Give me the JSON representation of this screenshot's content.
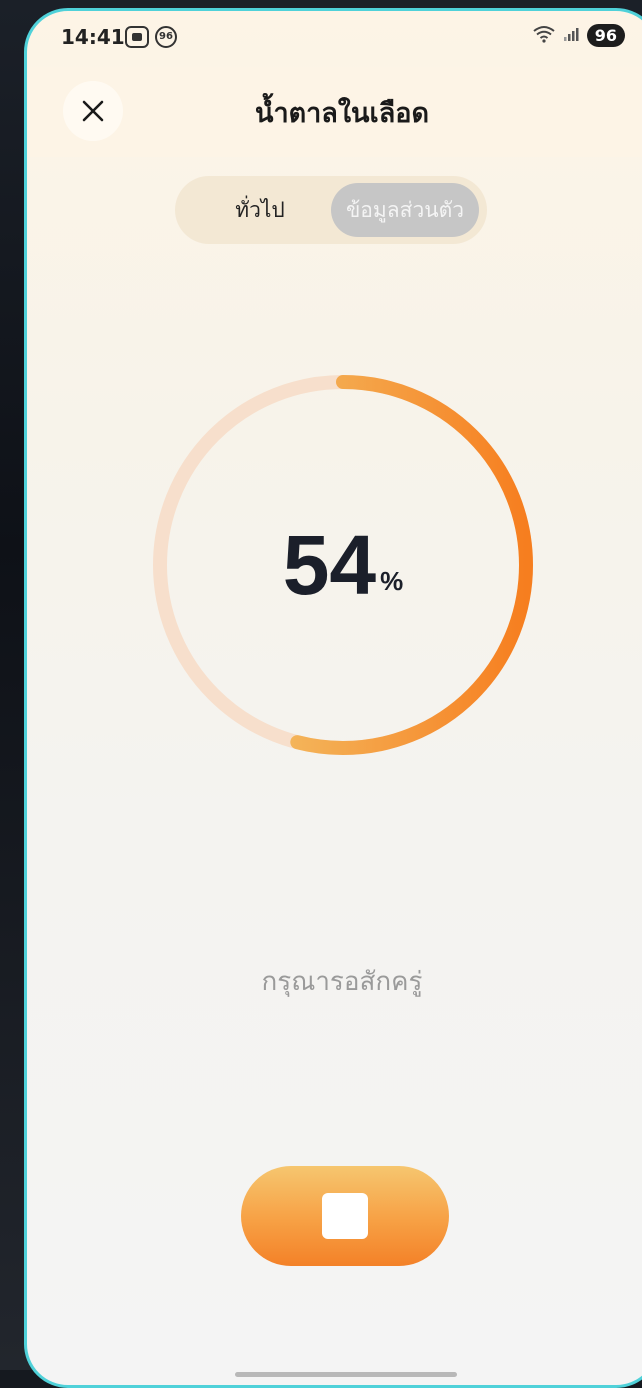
{
  "status_bar": {
    "time": "14:41",
    "notification_badge": "96",
    "battery": "96"
  },
  "header": {
    "title": "น้ำตาลในเลือด"
  },
  "tabs": {
    "general": "ทั่วไป",
    "personal": "ข้อมูลส่วนตัว",
    "selected": "personal"
  },
  "progress": {
    "value": 54,
    "unit": "%",
    "colors": {
      "track": "#f7dfcc",
      "start": "#f3d27a",
      "end": "#f67e1f"
    }
  },
  "message": "กรุณารอสักครู่",
  "controls": {
    "stop_icon": "stop-icon"
  }
}
